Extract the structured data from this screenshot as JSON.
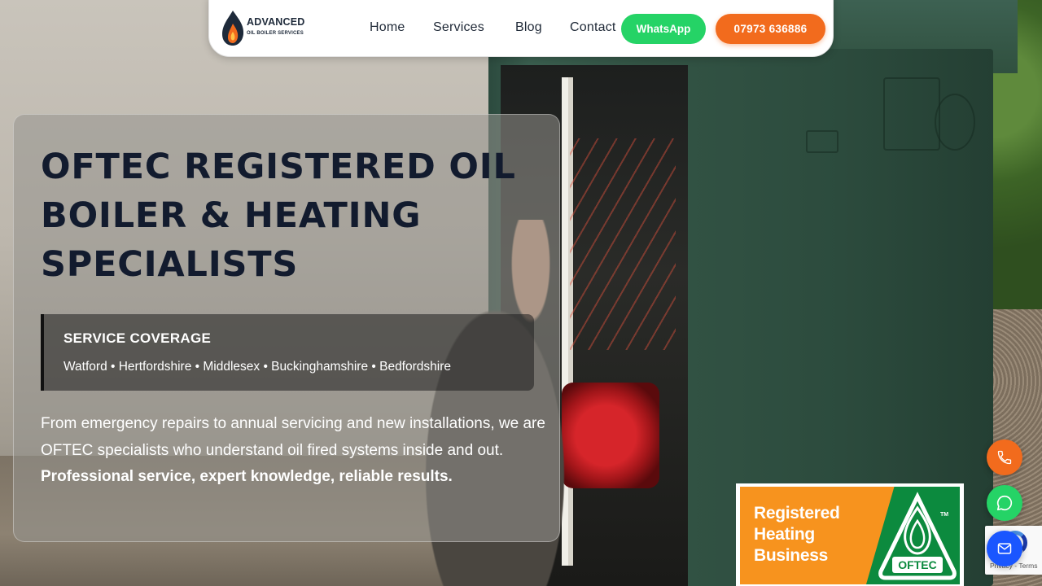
{
  "header": {
    "logo": {
      "main": "ADVANCED",
      "sub": "OIL BOILER SERVICES"
    },
    "nav": [
      "Home",
      "Services",
      "Blog",
      "Contact"
    ],
    "whatsapp_label": "WhatsApp",
    "phone_label": "07973 636886"
  },
  "hero": {
    "title": "OFTEC REGISTERED OIL BOILER & HEATING SPECIALISTS",
    "coverage": {
      "title": "SERVICE COVERAGE",
      "areas": "Watford • Hertfordshire • Middlesex • Buckinghamshire • Bedfordshire"
    },
    "text": "From emergency repairs to annual servicing and new installations, we are OFTEC specialists who understand oil fired systems inside and out.",
    "text_strong": "Professional service, expert knowledge, reliable results."
  },
  "floating": {
    "call_icon": "phone-icon",
    "whatsapp_icon": "whatsapp-icon",
    "mail_icon": "mail-icon"
  },
  "badge": {
    "line1": "Registered",
    "line2": "Heating",
    "line3": "Business",
    "logo_text": "OFTEC",
    "tm": "TM"
  },
  "recaptcha": {
    "privacy": "Privacy",
    "separator": "-",
    "terms": "Terms"
  },
  "colors": {
    "accent_orange": "#f26b1d",
    "whatsapp_green": "#25d366",
    "title_navy": "#121b2e",
    "mail_blue": "#1a56ff",
    "oftec_green": "#0c8a3e",
    "oftec_orange": "#f7931e"
  }
}
